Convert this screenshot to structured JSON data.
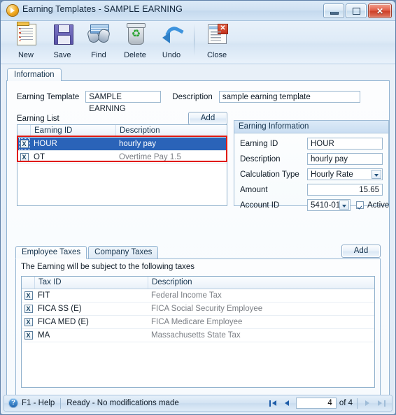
{
  "window": {
    "title": "Earning Templates - SAMPLE EARNING",
    "app_icon": "play-circle-icon",
    "minimize_label": "Minimize",
    "maximize_label": "Maximize",
    "close_label": "Close"
  },
  "toolbar": {
    "buttons": [
      {
        "label": "New",
        "icon": "new-document-icon"
      },
      {
        "label": "Save",
        "icon": "floppy-disk-icon"
      },
      {
        "label": "Find",
        "icon": "binoculars-icon"
      },
      {
        "label": "Delete",
        "icon": "recycle-bin-icon"
      },
      {
        "label": "Undo",
        "icon": "undo-arrow-icon"
      },
      {
        "label": "Close",
        "icon": "document-close-icon"
      }
    ]
  },
  "tabs": {
    "main": "Information"
  },
  "header_fields": {
    "earning_template_label": "Earning Template",
    "earning_template_value": "SAMPLE EARNING",
    "description_label": "Description",
    "description_value": "sample earning template"
  },
  "earning_list": {
    "caption": "Earning List",
    "add_label": "Add",
    "columns": [
      "",
      "Earning ID",
      "Description"
    ],
    "rows": [
      {
        "remove": "X",
        "earning_id": "HOUR",
        "description": "hourly pay",
        "selected": true
      },
      {
        "remove": "X",
        "earning_id": "OT",
        "description": "Overtime Pay 1.5",
        "selected": false
      }
    ],
    "highlight_color": "#e01b12"
  },
  "earning_information": {
    "title": "Earning Information",
    "fields": [
      {
        "label": "Earning ID",
        "value": "HOUR",
        "type": "text"
      },
      {
        "label": "Description",
        "value": "hourly pay",
        "type": "text"
      },
      {
        "label": "Calculation Type",
        "value": "Hourly Rate",
        "type": "combo"
      },
      {
        "label": "Amount",
        "value": "15.65",
        "type": "number"
      },
      {
        "label": "Account ID",
        "value": "5410-01",
        "type": "combo"
      }
    ],
    "active_label": "Active",
    "active_checked": true
  },
  "taxes": {
    "tabs": [
      {
        "label": "Employee Taxes",
        "active": true
      },
      {
        "label": "Company Taxes",
        "active": false
      }
    ],
    "note": "The Earning will be subject to the following taxes",
    "add_label": "Add",
    "columns": [
      "",
      "Tax ID",
      "Description"
    ],
    "rows": [
      {
        "remove": "X",
        "tax_id": "FIT",
        "description": "Federal Income Tax"
      },
      {
        "remove": "X",
        "tax_id": "FICA SS (E)",
        "description": "FICA Social Security Employee"
      },
      {
        "remove": "X",
        "tax_id": "FICA MED (E)",
        "description": "FICA Medicare Employee"
      },
      {
        "remove": "X",
        "tax_id": "MA",
        "description": "Massachusetts State Tax"
      }
    ]
  },
  "statusbar": {
    "help_icon": "question-mark-icon",
    "help_label": "F1 - Help",
    "status": "Ready - No modifications made",
    "nav": {
      "first_icon": "first-record-icon",
      "prev_icon": "previous-record-icon",
      "current": "4",
      "of_label": "of  4",
      "next_icon": "next-record-icon",
      "last_icon": "last-record-icon"
    }
  }
}
